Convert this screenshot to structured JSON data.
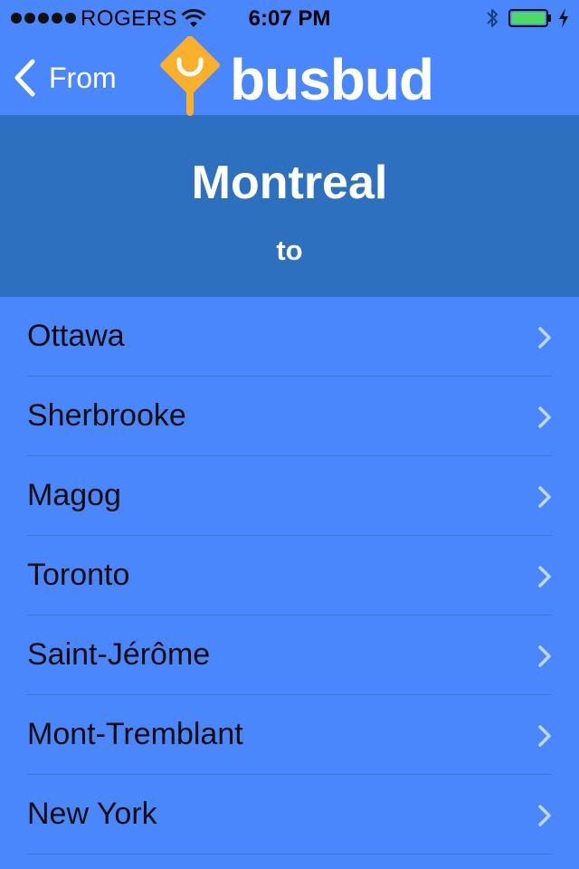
{
  "status_bar": {
    "carrier": "ROGERS",
    "time": "6:07 PM",
    "signal_icon": "signal-dots-icon",
    "wifi_icon": "wifi-icon",
    "bluetooth_icon": "bluetooth-icon",
    "battery_icon": "battery-icon",
    "battery_level": 1.0,
    "battery_color": "#4cd964",
    "charging_icon": "charging-bolt-icon"
  },
  "nav": {
    "back_label": "From",
    "back_icon": "chevron-left-icon",
    "logo_text": "busbud",
    "logo_color": "#f9b12c"
  },
  "origin": {
    "city": "Montreal",
    "connector": "to"
  },
  "destinations": [
    {
      "label": "Ottawa"
    },
    {
      "label": "Sherbrooke"
    },
    {
      "label": "Magog"
    },
    {
      "label": "Toronto"
    },
    {
      "label": "Saint-Jérôme"
    },
    {
      "label": "Mont-Tremblant"
    },
    {
      "label": "New York"
    }
  ],
  "colors": {
    "background": "#4b87fc",
    "header_band": "#2d70bf",
    "chevron": "#c4d6f8"
  }
}
